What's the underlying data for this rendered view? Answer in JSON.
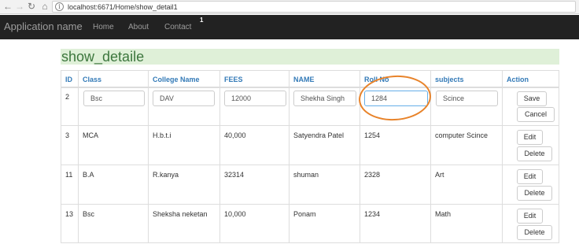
{
  "browser": {
    "url": "localhost:6671/Home/show_detail1",
    "back_icon": "back-arrow",
    "forward_icon": "forward-arrow",
    "reload_icon": "reload",
    "home_icon": "home"
  },
  "navbar": {
    "brand": "Application name",
    "items": [
      "Home",
      "About",
      "Contact"
    ],
    "annotation": "1"
  },
  "page": {
    "title": "show_detaile"
  },
  "table": {
    "headers": [
      "ID",
      "Class",
      "College Name",
      "FEES",
      "NAME",
      "Roll No",
      "subjects",
      "Action"
    ],
    "edit_row": {
      "id": "2",
      "class": "Bsc",
      "college": "DAV",
      "fees": "12000",
      "name": "Shekha Singh",
      "roll": "1284",
      "subject": "Scince",
      "save": "Save",
      "cancel": "Cancel"
    },
    "rows": [
      {
        "id": "3",
        "class": "MCA",
        "college": "H.b.t.i",
        "fees": "40,000",
        "name": "Satyendra Patel",
        "roll": "1254",
        "subject": "computer Scince",
        "edit": "Edit",
        "delete": "Delete"
      },
      {
        "id": "11",
        "class": "B.A",
        "college": "R.kanya",
        "fees": "32314",
        "name": "shuman",
        "roll": "2328",
        "subject": "Art",
        "edit": "Edit",
        "delete": "Delete"
      },
      {
        "id": "13",
        "class": "Bsc",
        "college": "Sheksha neketan",
        "fees": "10,000",
        "name": "Ponam",
        "roll": "1234",
        "subject": "Math",
        "edit": "Edit",
        "delete": "Delete"
      }
    ]
  },
  "colors": {
    "navbar_bg": "#222222",
    "title_bg": "#dff0d8",
    "title_fg": "#3c763d",
    "header_fg": "#337ab7",
    "annotation_ring": "#e8832a"
  }
}
